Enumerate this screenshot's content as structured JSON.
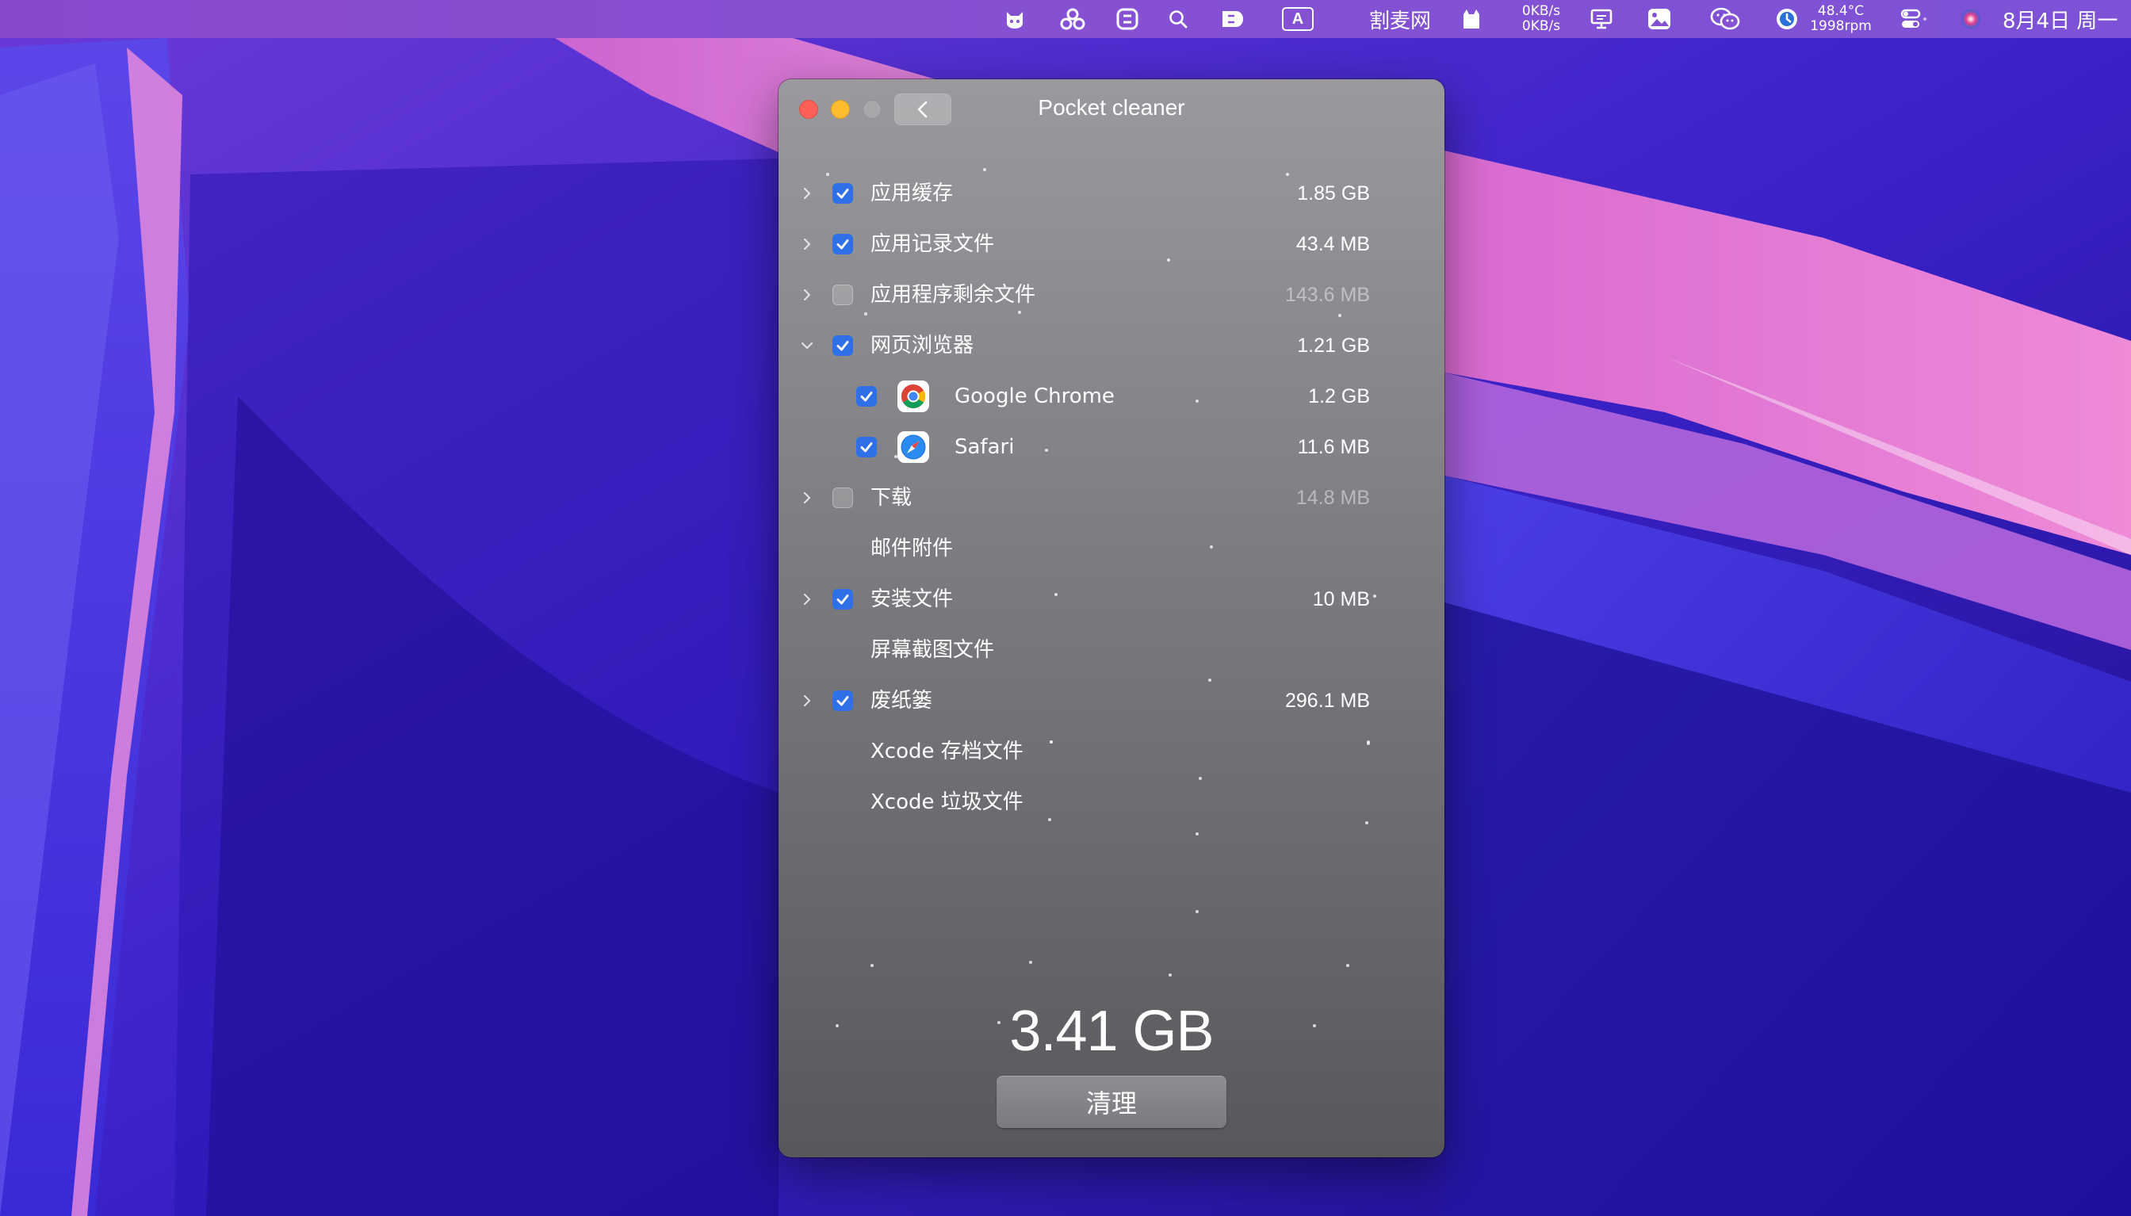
{
  "menubar": {
    "network_up": "0KB/s",
    "network_down": "0KB/s",
    "app_name": "割麦网",
    "cpu_temp": "48.4°C",
    "fan_speed": "1998rpm",
    "clock": "8月4日 周一",
    "input_method_label": "A"
  },
  "window": {
    "title": "Pocket cleaner"
  },
  "items": [
    {
      "label": "应用缓存",
      "size": "1.85 GB",
      "checked": true,
      "expandable": true,
      "expanded": false
    },
    {
      "label": "应用记录文件",
      "size": "43.4 MB",
      "checked": true,
      "expandable": true,
      "expanded": false
    },
    {
      "label": "应用程序剩余文件",
      "size": "143.6 MB",
      "checked": false,
      "expandable": true,
      "expanded": false
    },
    {
      "label": "网页浏览器",
      "size": "1.21 GB",
      "checked": true,
      "expandable": true,
      "expanded": true
    },
    {
      "label": "Google Chrome",
      "size": "1.2 GB",
      "checked": true,
      "child": true,
      "icon": "chrome-icon"
    },
    {
      "label": "Safari",
      "size": "11.6 MB",
      "checked": true,
      "child": true,
      "icon": "safari-icon"
    },
    {
      "label": "下载",
      "size": "14.8 MB",
      "checked": false,
      "expandable": true,
      "expanded": false
    },
    {
      "label": "邮件附件",
      "size": "",
      "checked": null,
      "expandable": false
    },
    {
      "label": "安装文件",
      "size": "10 MB",
      "checked": true,
      "expandable": true,
      "expanded": false
    },
    {
      "label": "屏幕截图文件",
      "size": "",
      "checked": null,
      "expandable": false
    },
    {
      "label": "废纸篓",
      "size": "296.1 MB",
      "checked": true,
      "expandable": true,
      "expanded": false
    },
    {
      "label": "Xcode 存档文件",
      "size": "",
      "checked": null,
      "expandable": false
    },
    {
      "label": "Xcode 垃圾文件",
      "size": "",
      "checked": null,
      "expandable": false
    }
  ],
  "footer": {
    "total_size": "3.41 GB",
    "clean_label": "清理"
  },
  "colors": {
    "checkbox_on": "#2f6fe8",
    "close": "#fe5f57",
    "minimize": "#febc2e",
    "zoom_disabled": "#a7a7aa"
  }
}
